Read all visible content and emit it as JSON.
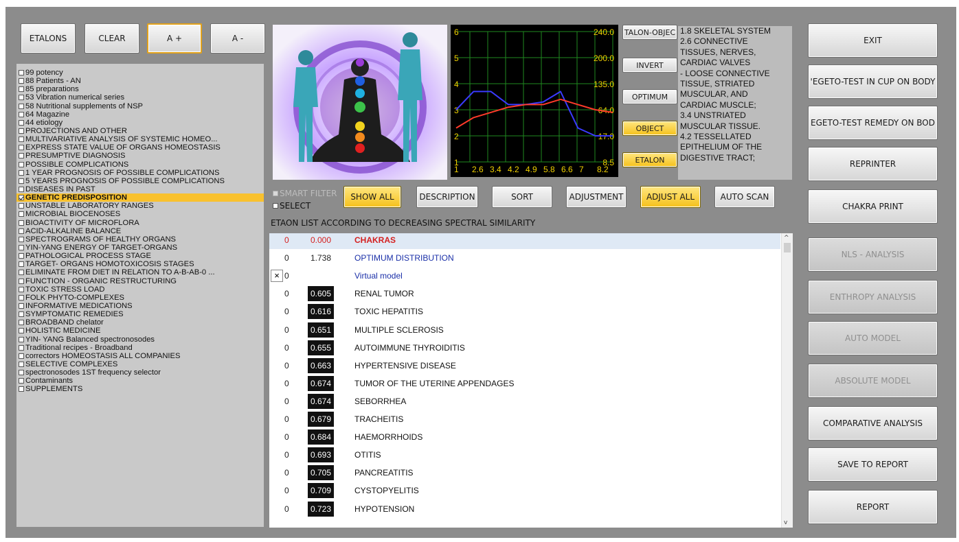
{
  "top_buttons": {
    "etalons": "ETALONS",
    "clear": "CLEAR",
    "a_plus": "A +",
    "a_minus": "A -"
  },
  "categories": [
    {
      "label": "99 potency",
      "checked": false,
      "selected": false
    },
    {
      "label": "88 Patients - AN",
      "checked": false,
      "selected": false
    },
    {
      "label": "85 preparations",
      "checked": false,
      "selected": false
    },
    {
      "label": "53 Vibration numerical series",
      "checked": false,
      "selected": false
    },
    {
      "label": "58 Nutritional supplements of NSP",
      "checked": false,
      "selected": false
    },
    {
      "label": "64 Magazine",
      "checked": false,
      "selected": false
    },
    {
      "label": "44 etiology",
      "checked": false,
      "selected": false
    },
    {
      "label": "PROJECTIONS AND OTHER",
      "checked": false,
      "selected": false
    },
    {
      "label": "MULTIVARIATIVE ANALYSIS OF SYSTEMIC HOMEO...",
      "checked": false,
      "selected": false
    },
    {
      "label": "EXPRESS STATE VALUE OF ORGANS HOMEOSTASIS",
      "checked": false,
      "selected": false
    },
    {
      "label": "PRESUMPTIVE DIAGNOSIS",
      "checked": false,
      "selected": false
    },
    {
      "label": "POSSIBLE COMPLICATIONS",
      "checked": false,
      "selected": false
    },
    {
      "label": "1 YEAR PROGNOSIS OF POSSIBLE COMPLICATIONS",
      "checked": false,
      "selected": false
    },
    {
      "label": "5 YEARS PROGNOSIS OF POSSIBLE COMPLICATIONS",
      "checked": false,
      "selected": false
    },
    {
      "label": "DISEASES IN PAST",
      "checked": false,
      "selected": false
    },
    {
      "label": "GENETIC PREDISPOSITION",
      "checked": true,
      "selected": true
    },
    {
      "label": "UNSTABLE LABORATORY RANGES",
      "checked": false,
      "selected": false
    },
    {
      "label": "MICROBIAL BIOCENOSES",
      "checked": false,
      "selected": false
    },
    {
      "label": "BIOACTIVITY OF MICROFLORA",
      "checked": false,
      "selected": false
    },
    {
      "label": "ACID-ALKALINE BALANCE",
      "checked": false,
      "selected": false
    },
    {
      "label": "SPECTROGRAMS OF HEALTHY ORGANS",
      "checked": false,
      "selected": false
    },
    {
      "label": "YIN-YANG ENERGY OF TARGET-ORGANS",
      "checked": false,
      "selected": false
    },
    {
      "label": "PATHOLOGICAL PROCESS STAGE",
      "checked": false,
      "selected": false
    },
    {
      "label": "TARGET- ORGANS HOMOTOXICOSIS STAGES",
      "checked": false,
      "selected": false
    },
    {
      "label": "ELIMINATE FROM DIET IN RELATION TO A-B-AB-0 ...",
      "checked": false,
      "selected": false
    },
    {
      "label": "FUNCTION - ORGANIC RESTRUCTURING",
      "checked": false,
      "selected": false
    },
    {
      "label": "TOXIC STRESS LOAD",
      "checked": false,
      "selected": false
    },
    {
      "label": "FOLK PHYTO-COMPLEXES",
      "checked": false,
      "selected": false
    },
    {
      "label": "INFORMATIVE MEDICATIONS",
      "checked": false,
      "selected": false
    },
    {
      "label": "SYMPTOMATIC REMEDIES",
      "checked": false,
      "selected": false
    },
    {
      "label": "BROADBAND chelator",
      "checked": false,
      "selected": false
    },
    {
      "label": "HOLISTIC MEDICINE",
      "checked": false,
      "selected": false
    },
    {
      "label": "YIN- YANG Balanced spectronosodes",
      "checked": false,
      "selected": false
    },
    {
      "label": "Traditional recipes - Broadband",
      "checked": false,
      "selected": false
    },
    {
      "label": "correctors HOMEOSTASIS ALL COMPANIES",
      "checked": false,
      "selected": false
    },
    {
      "label": "SELECTIVE COMPLEXES",
      "checked": false,
      "selected": false
    },
    {
      "label": "spectronosodes 1ST frequency selector",
      "checked": false,
      "selected": false
    },
    {
      "label": "Contaminants",
      "checked": false,
      "selected": false
    },
    {
      "label": "SUPPLEMENTS",
      "checked": false,
      "selected": false
    }
  ],
  "graph": {
    "left_labels": [
      "6",
      "5",
      "4",
      "3",
      "2",
      "1"
    ],
    "right_labels": [
      "240.0",
      "200.0",
      "135.0",
      "64.0",
      "17.0",
      "8.5"
    ],
    "bottom_labels": [
      "1",
      "2.6",
      "3.4",
      "4.2",
      "4.9",
      "5.8",
      "6.6",
      "7",
      "8.2"
    ],
    "grid_color": "#1f8a1f",
    "blue_series": [
      3.0,
      3.7,
      3.7,
      3.2,
      3.2,
      3.3,
      3.7,
      2.3,
      2.0,
      2.0
    ],
    "red_series": [
      2.3,
      2.7,
      2.9,
      3.1,
      3.2,
      3.2,
      3.4,
      3.2,
      3.0,
      2.9
    ]
  },
  "mid_buttons": {
    "etalon_object": "TALON-OBJEC",
    "invert": "INVERT",
    "optimum": "OPTIMUM",
    "object": "OBJECT",
    "etalon": "ETALON"
  },
  "info_lines": [
    "1.8 SKELETAL SYSTEM",
    "2.6 CONNECTIVE",
    "TISSUES, NERVES,",
    "CARDIAC VALVES",
    "- LOOSE CONNECTIVE",
    "TISSUE, STRIATED",
    "MUSCULAR, AND",
    "CARDIAC MUSCLE;",
    "3.4 UNSTRIATED",
    "MUSCULAR TISSUE.",
    "4.2 TESSELLATED",
    "EPITHELIUM OF THE",
    "DIGESTIVE TRACT;"
  ],
  "filters": {
    "smart_filter": "SMART FILTER",
    "select": "SELECT"
  },
  "toolbar": {
    "show_all": "SHOW ALL",
    "description": "DESCRIPTION",
    "sort": "SORT",
    "adjustment": "ADJUSTMENT",
    "adjust_all": "ADJUST ALL",
    "auto_scan": "AUTO SCAN"
  },
  "list_title": "ETAON LIST ACCORDING TO DECREASING SPECTRAL SIMILARITY",
  "rows": [
    {
      "n": "0",
      "val": "0.000",
      "name": "CHAKRAS",
      "style": "header"
    },
    {
      "n": "0",
      "val": "1.738",
      "name": "OPTIMUM DISTRIBUTION",
      "style": "blue"
    },
    {
      "n": "0",
      "val": "",
      "name": "Virtual model",
      "style": "virtual"
    },
    {
      "n": "0",
      "val": "0.605",
      "name": "RENAL TUMOR",
      "style": "dark"
    },
    {
      "n": "0",
      "val": "0.616",
      "name": "TOXIC HEPATITIS",
      "style": "dark"
    },
    {
      "n": "0",
      "val": "0.651",
      "name": "MULTIPLE SCLEROSIS",
      "style": "dark"
    },
    {
      "n": "0",
      "val": "0.655",
      "name": "AUTOIMMUNE THYROIDITIS",
      "style": "dark"
    },
    {
      "n": "0",
      "val": "0.663",
      "name": "HYPERTENSIVE DISEASE",
      "style": "dark"
    },
    {
      "n": "0",
      "val": "0.674",
      "name": "TUMOR OF THE UTERINE APPENDAGES",
      "style": "dark"
    },
    {
      "n": "0",
      "val": "0.674",
      "name": "SEBORRHEA",
      "style": "dark"
    },
    {
      "n": "0",
      "val": "0.679",
      "name": "TRACHEITIS",
      "style": "dark"
    },
    {
      "n": "0",
      "val": "0.684",
      "name": "HAEMORRHOIDS",
      "style": "dark"
    },
    {
      "n": "0",
      "val": "0.693",
      "name": "OTITIS",
      "style": "dark"
    },
    {
      "n": "0",
      "val": "0.705",
      "name": "PANCREATITIS",
      "style": "dark"
    },
    {
      "n": "0",
      "val": "0.709",
      "name": "CYSTOPYELITIS",
      "style": "dark"
    },
    {
      "n": "0",
      "val": "0.723",
      "name": "HYPOTENSION",
      "style": "dark"
    }
  ],
  "right_buttons": [
    {
      "label": "EXIT",
      "enabled": true
    },
    {
      "label": "'EGETO-TEST IN CUP ON BODY",
      "enabled": true
    },
    {
      "label": "EGETO-TEST REMEDY ON BOD",
      "enabled": true
    },
    {
      "label": "REPRINTER",
      "enabled": true
    },
    {
      "label": "CHAKRA PRINT",
      "enabled": true
    },
    {
      "label": "NLS - ANALYSIS",
      "enabled": false
    },
    {
      "label": "ENTHROPY ANALYSIS",
      "enabled": false
    },
    {
      "label": "AUTO MODEL",
      "enabled": false
    },
    {
      "label": "ABSOLUTE MODEL",
      "enabled": false
    },
    {
      "label": "COMPARATIVE ANALYSIS",
      "enabled": true
    },
    {
      "label": "SAVE TO REPORT",
      "enabled": true
    },
    {
      "label": "REPORT",
      "enabled": true
    }
  ],
  "colors": {
    "background": "#8c8c8c",
    "highlight": "#f9c12e",
    "header_red": "#d42020",
    "optimum_blue": "#1a2fa8"
  }
}
